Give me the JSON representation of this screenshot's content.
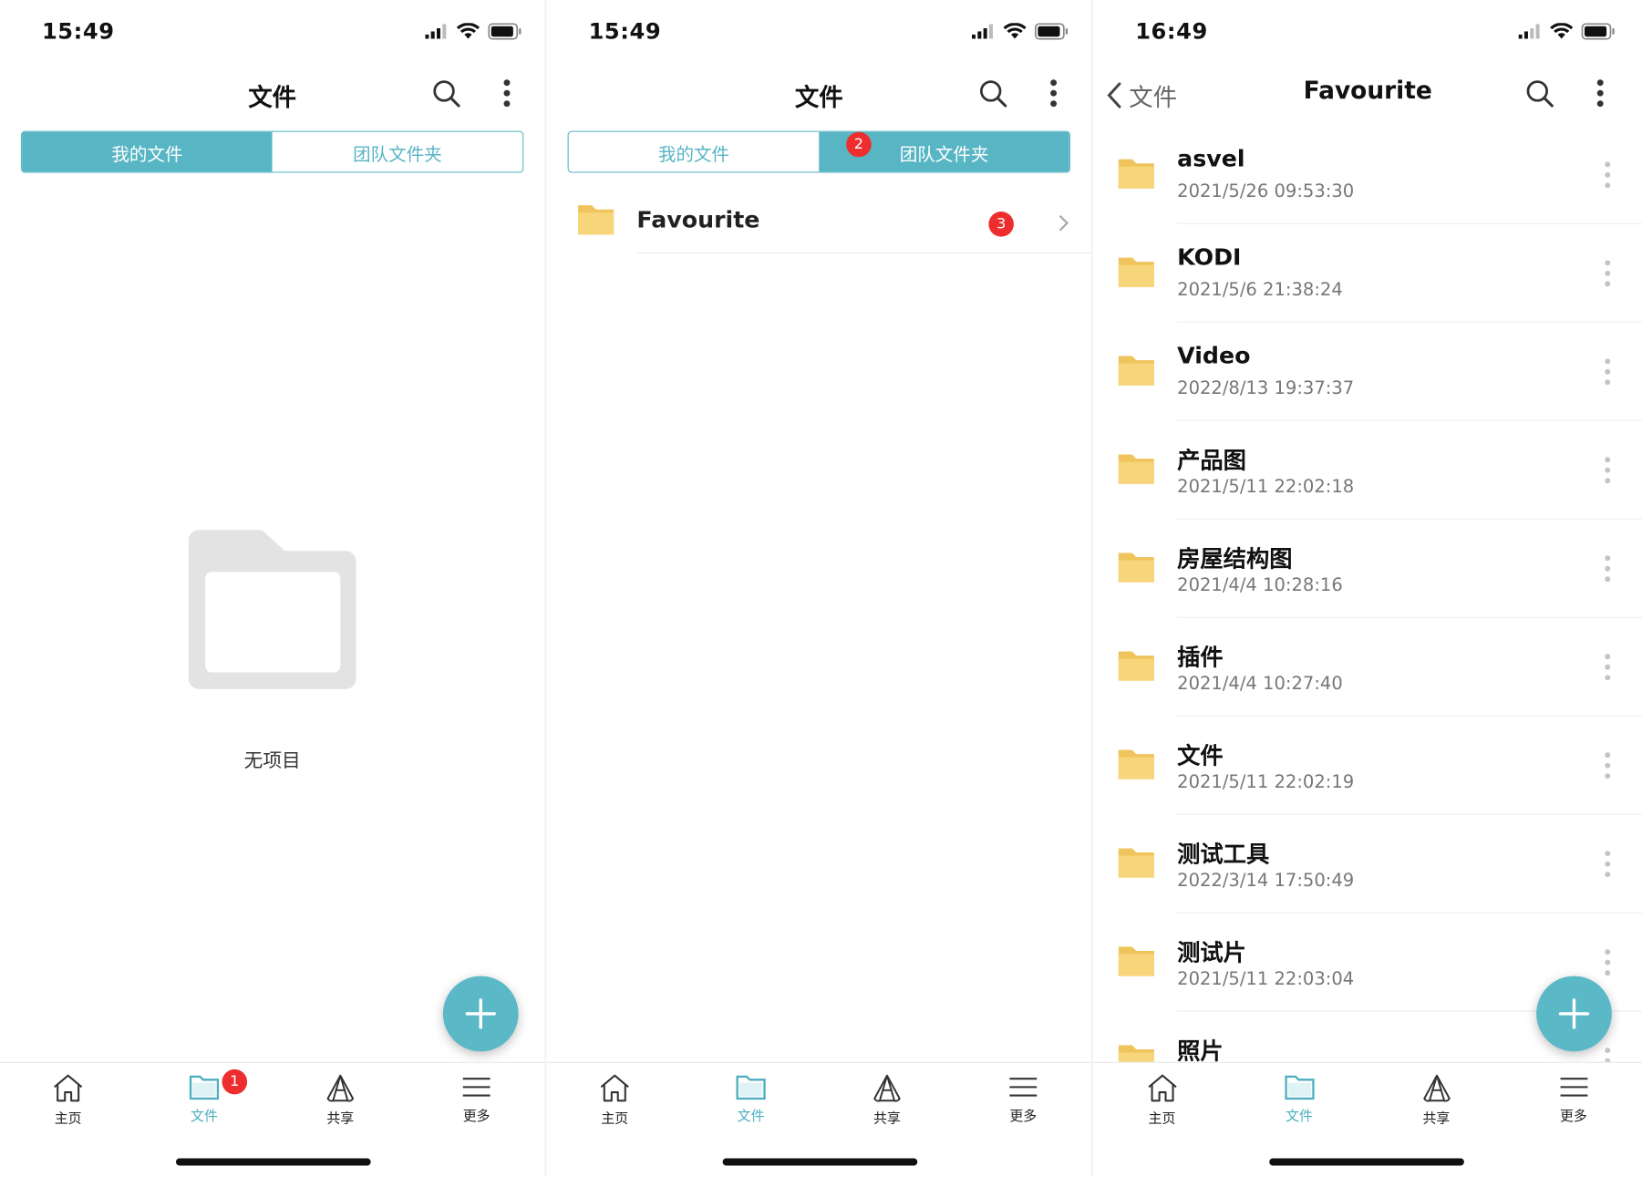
{
  "colors": {
    "accent": "#58b5c4",
    "badge": "#ee2e2e",
    "folder": "#f7d57a"
  },
  "screens": [
    {
      "status_time": "15:49",
      "title": "文件",
      "tabs": {
        "my_files": "我的文件",
        "team_folders": "团队文件夹",
        "active": "my_files"
      },
      "empty_text": "无项目",
      "nav_badge": "1"
    },
    {
      "status_time": "15:49",
      "title": "文件",
      "tabs": {
        "my_files": "我的文件",
        "team_folders": "团队文件夹",
        "active": "team_folders"
      },
      "tab_badge": "2",
      "team_folder": {
        "name": "Favourite",
        "badge": "3"
      }
    },
    {
      "status_time": "16:49",
      "back_label": "文件",
      "title": "Favourite",
      "items": [
        {
          "name": "asvel",
          "date": "2021/5/26 09:53:30"
        },
        {
          "name": "KODI",
          "date": "2021/5/6 21:38:24"
        },
        {
          "name": "Video",
          "date": "2022/8/13 19:37:37"
        },
        {
          "name": "产品图",
          "date": "2021/5/11 22:02:18"
        },
        {
          "name": "房屋结构图",
          "date": "2021/4/4 10:28:16"
        },
        {
          "name": "插件",
          "date": "2021/4/4 10:27:40"
        },
        {
          "name": "文件",
          "date": "2021/5/11 22:02:19"
        },
        {
          "name": "测试工具",
          "date": "2022/3/14 17:50:49"
        },
        {
          "name": "测试片",
          "date": "2021/5/11 22:03:04"
        },
        {
          "name": "照片",
          "date": ""
        }
      ]
    }
  ],
  "tabbar": {
    "home": "主页",
    "files": "文件",
    "share": "共享",
    "more": "更多"
  }
}
